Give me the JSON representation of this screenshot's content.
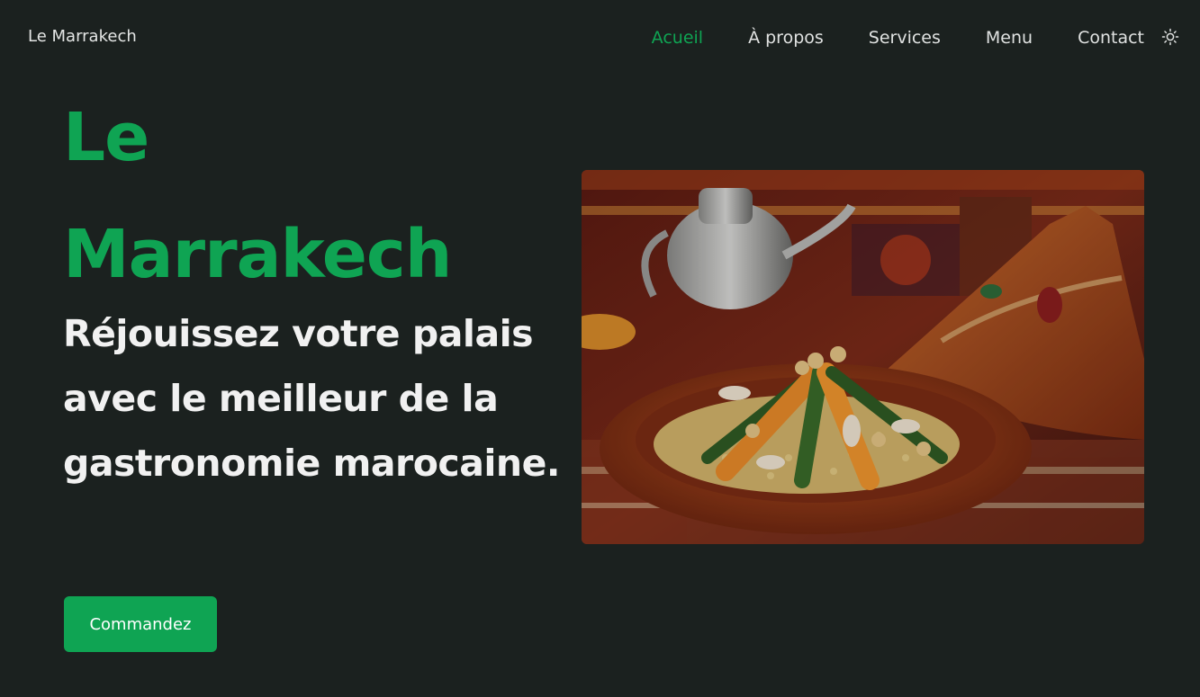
{
  "header": {
    "brand": "Le Marrakech",
    "nav": [
      {
        "label": "Acueil",
        "active": true
      },
      {
        "label": "À propos",
        "active": false
      },
      {
        "label": "Services",
        "active": false
      },
      {
        "label": "Menu",
        "active": false
      },
      {
        "label": "Contact",
        "active": false
      }
    ],
    "theme_toggle_icon": "sun-icon"
  },
  "hero": {
    "title_line1": "Le",
    "title_line2": "Marrakech",
    "subtitle": "Réjouissez votre palais avec le meilleur de la gastronomie marocaine.",
    "cta_label": "Commandez",
    "image_icon": "tagine-dish-photo"
  },
  "colors": {
    "background": "#1b211f",
    "accent": "#0fa453",
    "text": "#f1f1f1"
  }
}
